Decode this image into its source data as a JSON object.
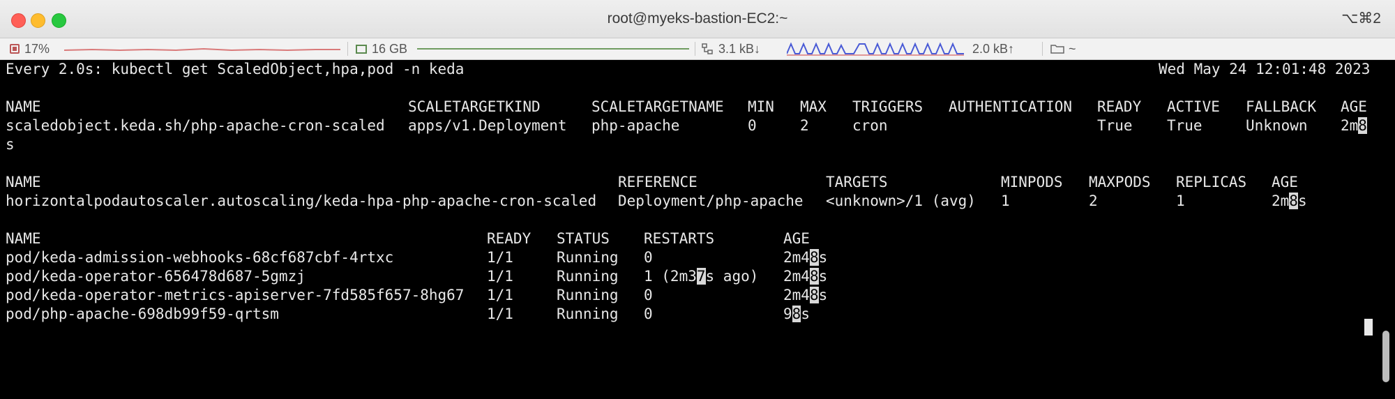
{
  "window": {
    "title": "root@myeks-bastion-EC2:~",
    "shortcut": "⌥⌘2"
  },
  "statusbar": {
    "cpu": "17%",
    "memory": "16 GB",
    "net_down": "3.1 kB↓",
    "net_up": "2.0 kB↑",
    "path": "~",
    "icons": [
      "cpu-icon",
      "memory-icon",
      "network-icon",
      "folder-icon"
    ]
  },
  "terminal": {
    "header": {
      "command": "Every 2.0s: kubectl get ScaledObject,hpa,pod -n keda",
      "timestamp": "Wed May 24 12:01:48 2023"
    },
    "scaledobject": {
      "headers": [
        "NAME",
        "SCALETARGETKIND",
        "SCALETARGETNAME",
        "MIN",
        "MAX",
        "TRIGGERS",
        "AUTHENTICATION",
        "READY",
        "ACTIVE",
        "FALLBACK",
        "AGE"
      ],
      "row": {
        "name": "scaledobject.keda.sh/php-apache-cron-scaled",
        "kind": "apps/v1.Deployment",
        "target": "php-apache",
        "min": "0",
        "max": "2",
        "triggers": "cron",
        "authentication": "",
        "ready": "True",
        "active": "True",
        "fallback": "Unknown",
        "age_a": "2m",
        "age_b": "8",
        "age_wrap": "s"
      }
    },
    "hpa": {
      "headers": [
        "NAME",
        "REFERENCE",
        "TARGETS",
        "MINPODS",
        "MAXPODS",
        "REPLICAS",
        "AGE"
      ],
      "row": {
        "name": "horizontalpodautoscaler.autoscaling/keda-hpa-php-apache-cron-scaled",
        "reference": "Deployment/php-apache",
        "targets": "<unknown>/1 (avg)",
        "minpods": "1",
        "maxpods": "2",
        "replicas": "1",
        "age_a": "2m",
        "age_b": "8",
        "age_c": "s"
      }
    },
    "pods": {
      "headers": [
        "NAME",
        "READY",
        "STATUS",
        "RESTARTS",
        "AGE"
      ],
      "rows": [
        {
          "name": "pod/keda-admission-webhooks-68cf687cbf-4rtxc",
          "ready": "1/1",
          "status": "Running",
          "restarts_a": "0",
          "restarts_b": "",
          "restarts_c": "",
          "age_a": "2m4",
          "age_b": "8",
          "age_c": "s"
        },
        {
          "name": "pod/keda-operator-656478d687-5gmzj",
          "ready": "1/1",
          "status": "Running",
          "restarts_a": "1 (2m3",
          "restarts_b": "7",
          "restarts_c": "s ago)",
          "age_a": "2m4",
          "age_b": "8",
          "age_c": "s"
        },
        {
          "name": "pod/keda-operator-metrics-apiserver-7fd585f657-8hg67",
          "ready": "1/1",
          "status": "Running",
          "restarts_a": "0",
          "restarts_b": "",
          "restarts_c": "",
          "age_a": "2m4",
          "age_b": "8",
          "age_c": "s"
        },
        {
          "name": "pod/php-apache-698db99f59-qrtsm",
          "ready": "1/1",
          "status": "Running",
          "restarts_a": "0",
          "restarts_b": "",
          "restarts_c": "",
          "age_a": "9",
          "age_b": "8",
          "age_c": "s"
        }
      ]
    }
  },
  "colors": {
    "terminal_bg": "#000000",
    "terminal_fg": "#e8e8e8",
    "cpu_graph": "#d97a7a",
    "mem_graph": "#6f9c5f",
    "net_graph": "#4a5bd6"
  }
}
